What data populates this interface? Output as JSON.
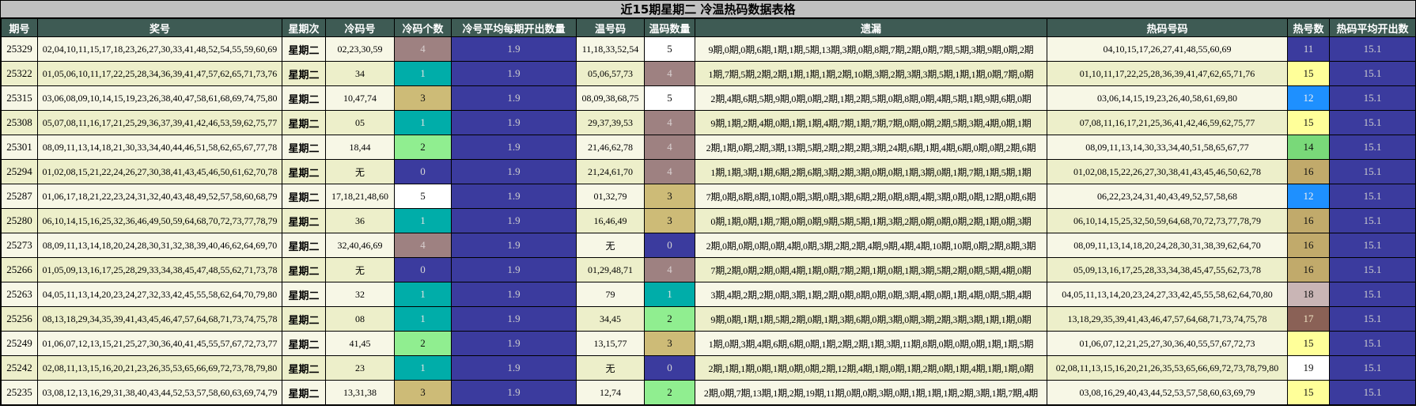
{
  "title": "近15期星期二 冷温热码数据表格",
  "row_colors": [
    "#f7f7e6",
    "#edefca"
  ],
  "avg_cell": {
    "bg": "#3b3b9e",
    "fg": "#cfcfcf"
  },
  "value_colors": {
    "0": {
      "bg": "#3b3b9e",
      "fg": "#d6d6d6"
    },
    "1": {
      "bg": "#00ada9",
      "fg": "#e3e3e3"
    },
    "2": {
      "bg": "#90ee90",
      "fg": "#111111"
    },
    "3": {
      "bg": "#cdbb77",
      "fg": "#111111"
    },
    "4": {
      "bg": "#9e8181",
      "fg": "#d8cfcf"
    },
    "5": {
      "bg": "#ffffff",
      "fg": "#111111"
    },
    "11": {
      "bg": "#3b3b9e",
      "fg": "#d6d6d6"
    },
    "12": {
      "bg": "#1e90ff",
      "fg": "#f0f0f0"
    },
    "14": {
      "bg": "#79d979",
      "fg": "#111111"
    },
    "15": {
      "bg": "#ffff99",
      "fg": "#111111"
    },
    "16": {
      "bg": "#c1aa6b",
      "fg": "#111111"
    },
    "17": {
      "bg": "#8a6156",
      "fg": "#efe3c2"
    },
    "18": {
      "bg": "#c9b5b5",
      "fg": "#111111"
    },
    "19": {
      "bg": "#ffffff",
      "fg": "#111111"
    }
  },
  "chart_data": {
    "type": "table",
    "title": "近15期星期二 冷温热码数据表格",
    "columns": [
      "期号",
      "奖号",
      "星期次",
      "冷码号",
      "冷码个数",
      "冷号平均每期开出数量",
      "温号码",
      "温码数量",
      "遗漏",
      "热码号码",
      "热号数",
      "热码平均开出数"
    ],
    "rows": [
      [
        "25329",
        "02,04,10,11,15,17,18,23,26,27,30,33,41,48,52,54,55,59,60,69",
        "星期二",
        "02,23,30,59",
        4,
        "1.9",
        "11,18,33,52,54",
        5,
        "9期,0期,0期,6期,1期,1期,5期,13期,3期,0期,8期,7期,2期,0期,7期,5期,3期,9期,0期,2期",
        "04,10,15,17,26,27,41,48,55,60,69",
        11,
        "15.1"
      ],
      [
        "25322",
        "01,05,06,10,11,17,22,25,28,34,36,39,41,47,57,62,65,71,73,76",
        "星期二",
        "34",
        1,
        "1.9",
        "05,06,57,73",
        4,
        "1期,7期,5期,2期,2期,1期,1期,1期,2期,10期,3期,2期,3期,3期,5期,1期,1期,0期,7期,0期",
        "01,10,11,17,22,25,28,36,39,41,47,62,65,71,76",
        15,
        "15.1"
      ],
      [
        "25315",
        "03,06,08,09,10,14,15,19,23,26,38,40,47,58,61,68,69,74,75,80",
        "星期二",
        "10,47,74",
        3,
        "1.9",
        "08,09,38,68,75",
        5,
        "2期,4期,6期,5期,9期,0期,0期,2期,1期,2期,5期,0期,8期,0期,4期,5期,1期,9期,6期,0期",
        "03,06,14,15,19,23,26,40,58,61,69,80",
        12,
        "15.1"
      ],
      [
        "25308",
        "05,07,08,11,16,17,21,25,29,36,37,39,41,42,46,53,59,62,75,77",
        "星期二",
        "05",
        1,
        "1.9",
        "29,37,39,53",
        4,
        "9期,1期,2期,4期,0期,1期,1期,4期,7期,1期,7期,7期,0期,0期,2期,5期,3期,4期,0期,1期",
        "07,08,11,16,17,21,25,36,41,42,46,59,62,75,77",
        15,
        "15.1"
      ],
      [
        "25301",
        "08,09,11,13,14,18,21,30,33,34,40,44,46,51,58,62,65,67,77,78",
        "星期二",
        "18,44",
        2,
        "1.9",
        "21,46,62,78",
        4,
        "2期,1期,0期,2期,3期,13期,5期,2期,2期,2期,3期,24期,6期,1期,4期,6期,0期,0期,2期,6期",
        "08,09,11,13,14,30,33,34,40,51,58,65,67,77",
        14,
        "15.1"
      ],
      [
        "25294",
        "01,02,08,15,21,22,24,26,27,30,38,41,43,45,46,50,61,62,70,78",
        "星期二",
        "无",
        0,
        "1.9",
        "21,24,61,70",
        4,
        "1期,1期,3期,1期,6期,2期,6期,3期,2期,3期,0期,0期,1期,3期,0期,1期,7期,1期,5期,1期",
        "01,02,08,15,22,26,27,30,38,41,43,45,46,50,62,78",
        16,
        "15.1"
      ],
      [
        "25287",
        "01,06,17,18,21,22,23,24,31,32,40,43,48,49,52,57,58,60,68,79",
        "星期二",
        "17,18,21,48,60",
        5,
        "1.9",
        "01,32,79",
        3,
        "7期,0期,8期,8期,10期,0期,3期,0期,3期,6期,2期,0期,8期,4期,3期,0期,0期,12期,0期,6期",
        "06,22,23,24,31,40,43,49,52,57,58,68",
        12,
        "15.1"
      ],
      [
        "25280",
        "06,10,14,15,16,25,32,36,46,49,50,59,64,68,70,72,73,77,78,79",
        "星期二",
        "36",
        1,
        "1.9",
        "16,46,49",
        3,
        "0期,1期,0期,1期,7期,0期,0期,9期,5期,5期,1期,3期,2期,0期,0期,0期,2期,1期,0期,3期",
        "06,10,14,15,25,32,50,59,64,68,70,72,73,77,78,79",
        16,
        "15.1"
      ],
      [
        "25273",
        "08,09,11,13,14,18,20,24,28,30,31,32,38,39,40,46,62,64,69,70",
        "星期二",
        "32,40,46,69",
        4,
        "1.9",
        "无",
        0,
        "2期,0期,0期,0期,0期,4期,0期,3期,2期,2期,4期,9期,4期,4期,10期,10期,0期,2期,8期,3期",
        "08,09,11,13,14,18,20,24,28,30,31,38,39,62,64,70",
        16,
        "15.1"
      ],
      [
        "25266",
        "01,05,09,13,16,17,25,28,29,33,34,38,45,47,48,55,62,71,73,78",
        "星期二",
        "无",
        0,
        "1.9",
        "01,29,48,71",
        4,
        "7期,2期,0期,2期,0期,4期,1期,0期,7期,2期,1期,0期,1期,3期,5期,2期,0期,5期,4期,0期",
        "05,09,13,16,17,25,28,33,34,38,45,47,55,62,73,78",
        16,
        "15.1"
      ],
      [
        "25263",
        "04,05,11,13,14,20,23,24,27,32,33,42,45,55,58,62,64,70,79,80",
        "星期二",
        "32",
        1,
        "1.9",
        "79",
        1,
        "3期,4期,2期,2期,0期,3期,1期,2期,0期,8期,0期,0期,3期,4期,0期,1期,4期,0期,5期,4期",
        "04,05,11,13,14,20,23,24,27,33,42,45,55,58,62,64,70,80",
        18,
        "15.1"
      ],
      [
        "25256",
        "08,13,18,29,34,35,39,41,43,45,46,47,57,64,68,71,73,74,75,78",
        "星期二",
        "08",
        1,
        "1.9",
        "34,45",
        2,
        "9期,0期,1期,1期,5期,2期,0期,1期,3期,6期,0期,3期,0期,3期,2期,3期,3期,1期,1期,0期",
        "13,18,29,35,39,41,43,46,47,57,64,68,71,73,74,75,78",
        17,
        "15.1"
      ],
      [
        "25249",
        "01,06,07,12,13,15,21,25,27,30,36,40,41,45,55,57,67,72,73,77",
        "星期二",
        "41,45",
        2,
        "1.9",
        "13,15,77",
        3,
        "1期,0期,3期,4期,6期,6期,0期,1期,2期,2期,1期,3期,11期,8期,0期,0期,0期,1期,1期,5期",
        "01,06,07,12,21,25,27,30,36,40,55,57,67,72,73",
        15,
        "15.1"
      ],
      [
        "25242",
        "02,08,11,13,15,16,20,21,23,26,35,53,65,66,69,72,73,78,79,80",
        "星期二",
        "23",
        1,
        "1.9",
        "无",
        0,
        "2期,1期,1期,0期,1期,0期,0期,2期,12期,4期,1期,0期,1期,2期,0期,1期,4期,1期,1期,0期",
        "02,08,11,13,15,16,20,21,26,35,53,65,66,69,72,73,78,79,80",
        19,
        "15.1"
      ],
      [
        "25235",
        "03,08,12,13,16,29,31,38,40,43,44,52,53,57,58,60,63,69,74,79",
        "星期二",
        "13,31,38",
        3,
        "1.9",
        "12,74",
        2,
        "2期,0期,7期,13期,1期,2期,19期,11期,0期,0期,3期,0期,1期,1期,1期,2期,3期,1期,7期,4期",
        "03,08,16,29,40,43,44,52,53,57,58,60,63,69,79",
        15,
        "15.1"
      ]
    ]
  }
}
